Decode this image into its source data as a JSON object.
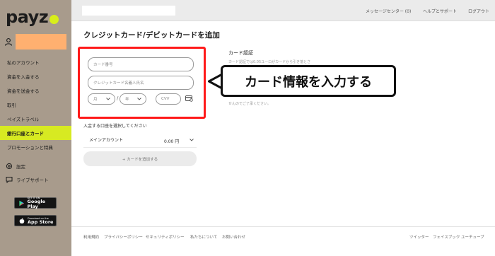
{
  "brand": {
    "logo_text": "payz"
  },
  "sidebar": {
    "items": [
      {
        "label": "私のアカウント"
      },
      {
        "label": "資金を入金する"
      },
      {
        "label": "資金を送金する"
      },
      {
        "label": "取引"
      },
      {
        "label": "ペイズトラベル"
      },
      {
        "label": "銀行口座とカード"
      },
      {
        "label": "プロモーションと特典"
      }
    ],
    "active_index": 5,
    "settings_label": "設定",
    "support_label": "ライブサポート",
    "google_play": {
      "small": "GET IT ON",
      "large": "Google Play"
    },
    "app_store": {
      "small": "Download on the",
      "large": "App Store"
    }
  },
  "topbar": {
    "links": [
      "メッセージセンター (0)",
      "ヘルプとサポート",
      "ログアウト"
    ]
  },
  "main": {
    "title": "クレジットカード/デビットカードを追加",
    "form": {
      "card_number_placeholder": "カード番号",
      "cardholder_placeholder": "クレジットカード名義人氏名",
      "month_placeholder": "月",
      "year_placeholder": "年",
      "separator": "/",
      "cvv_placeholder": "CVV"
    },
    "account_section_label": "入金する口座を選択してください",
    "account": {
      "name": "メインアカウント",
      "amount": "0.00 円"
    },
    "add_card_button": "+ カードを追加する"
  },
  "auth": {
    "title": "カード認証",
    "line1": "カード認証では0.05ユーロがカードから引き落とさ",
    "line2": "せんのでご了承ください。"
  },
  "callout": {
    "text": "カード情報を入力する"
  },
  "footer": {
    "left_links": [
      "利用規約",
      "プライバシーポリシー",
      "セキュリティポリシー",
      "私たちについて",
      "お問い合わせ"
    ],
    "right_links": [
      "ツイッター",
      "フェイスブック",
      "ユーチューブ"
    ]
  },
  "colors": {
    "sidebar_bg": "#a89b8c",
    "accent": "#d7ea22",
    "highlight_border": "#ff1a1a",
    "username_mask": "#ffb070"
  }
}
